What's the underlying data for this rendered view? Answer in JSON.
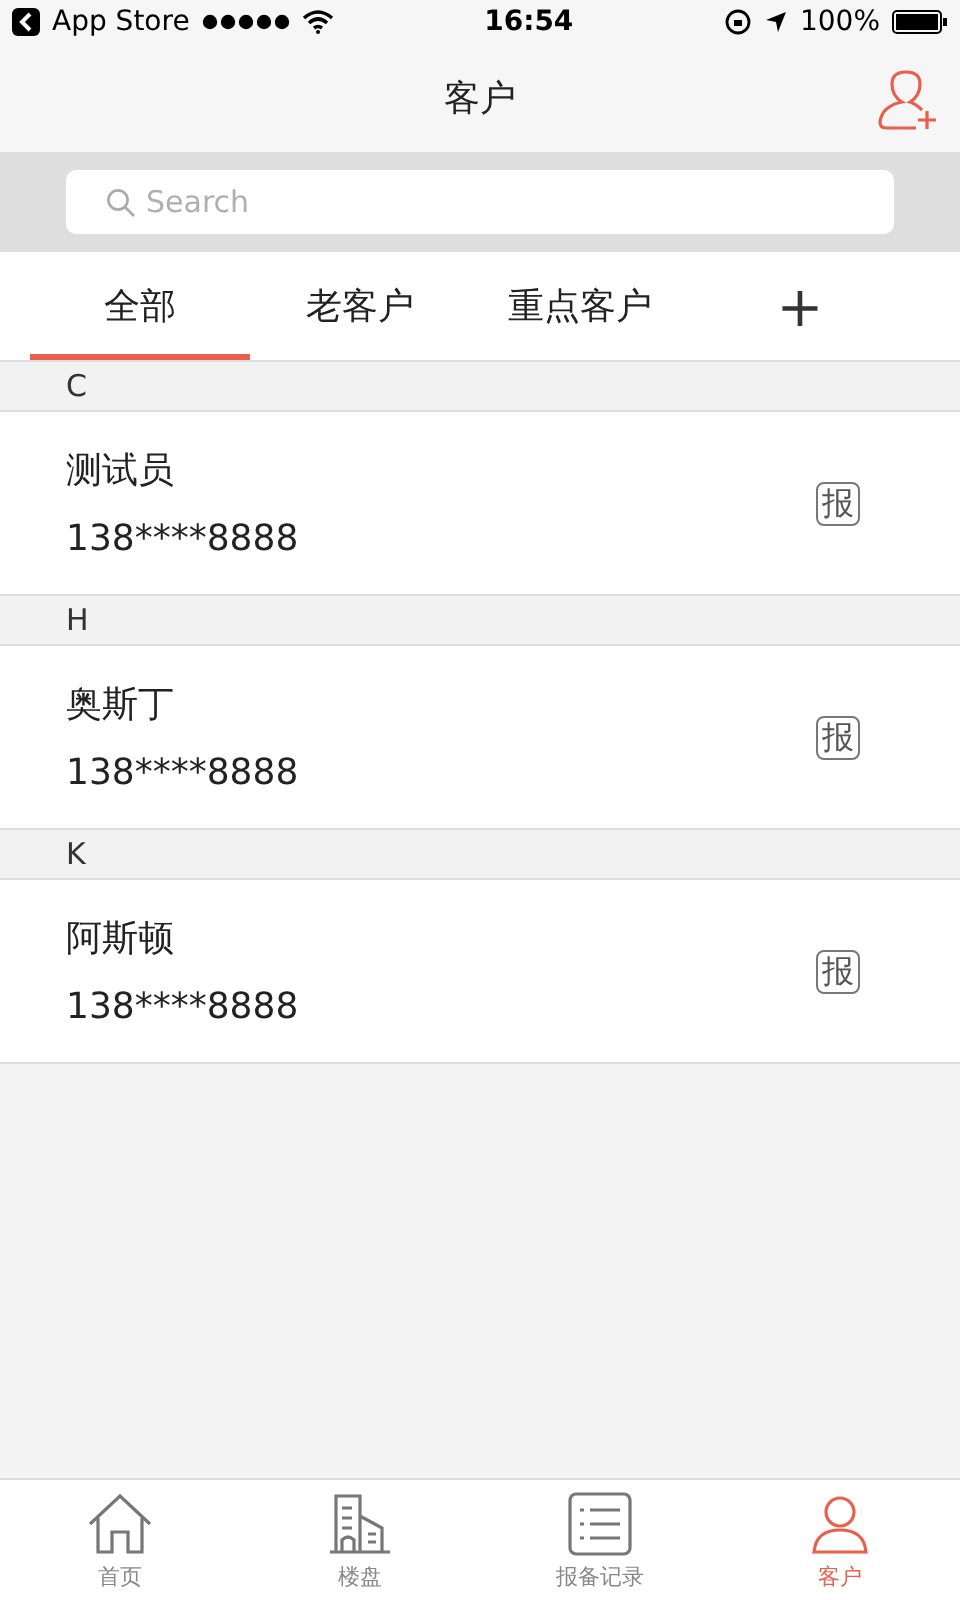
{
  "status_bar": {
    "carrier": "App Store",
    "time": "16:54",
    "battery": "100%"
  },
  "nav": {
    "title": "客户"
  },
  "search": {
    "placeholder": "Search"
  },
  "tabs": [
    {
      "label": "全部",
      "selected": true
    },
    {
      "label": "老客户",
      "selected": false
    },
    {
      "label": "重点客户",
      "selected": false
    }
  ],
  "add_tab": "+",
  "sections": [
    {
      "letter": "C",
      "customers": [
        {
          "name": "测试员",
          "phone": "138****8888",
          "badge": "报"
        }
      ]
    },
    {
      "letter": "H",
      "customers": [
        {
          "name": "奥斯丁",
          "phone": "138****8888",
          "badge": "报"
        }
      ]
    },
    {
      "letter": "K",
      "customers": [
        {
          "name": "阿斯顿",
          "phone": "138****8888",
          "badge": "报"
        }
      ]
    }
  ],
  "tab_bar": [
    {
      "label": "首页",
      "kind": "home",
      "selected": false
    },
    {
      "label": "楼盘",
      "kind": "building",
      "selected": false
    },
    {
      "label": "报备记录",
      "kind": "list",
      "selected": false
    },
    {
      "label": "客户",
      "kind": "person",
      "selected": true
    }
  ]
}
